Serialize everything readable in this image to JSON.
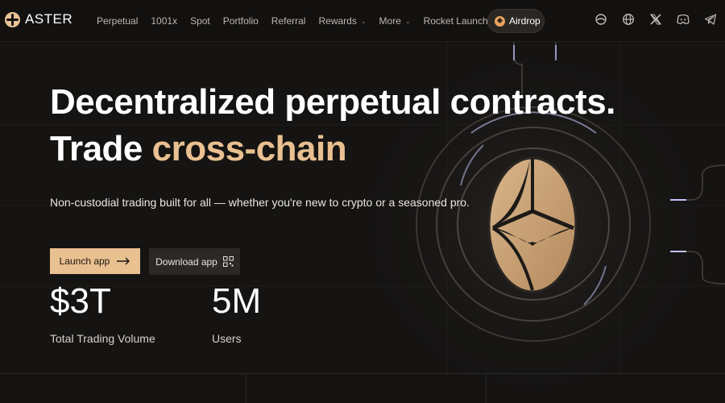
{
  "nav": {
    "brand": "ASTER",
    "items": [
      {
        "label": "Perpetual"
      },
      {
        "label": "1001x"
      },
      {
        "label": "Spot"
      },
      {
        "label": "Portfolio"
      },
      {
        "label": "Referral"
      },
      {
        "label": "Rewards",
        "dropdown": true
      },
      {
        "label": "More",
        "dropdown": true
      },
      {
        "label": "Rocket Launch",
        "badge": "flame-icon"
      }
    ],
    "airdrop_label": "Airdrop",
    "social_icons": [
      "globe-outline-icon",
      "globe-icon",
      "x-icon",
      "discord-icon",
      "telegram-icon"
    ]
  },
  "hero": {
    "title_line1": "Decentralized perpetual contracts.",
    "title_line2_prefix": "Trade ",
    "title_line2_accent": "cross-chain",
    "subtitle": "Non-custodial trading built for all — whether you're new to crypto or a seasoned pro.",
    "launch_label": "Launch app",
    "download_label": "Download app"
  },
  "stats": [
    {
      "value": "$3T",
      "label": "Total Trading Volume"
    },
    {
      "value": "5M",
      "label": "Users"
    }
  ],
  "colors": {
    "accent": "#e9c090",
    "background": "#151413",
    "nav_background": "#121110"
  }
}
